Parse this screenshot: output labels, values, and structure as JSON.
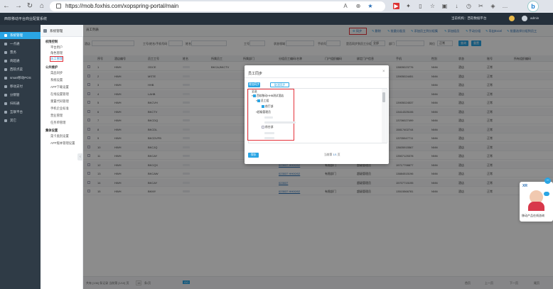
{
  "browser": {
    "url": "https://mob.foxhis.com/xopspring-portal/main"
  },
  "header": {
    "title": "西软移动平台商业配置系统",
    "right_org": "当前机构：西软数据平台",
    "right_user": "admin"
  },
  "sidebar": {
    "items": [
      {
        "label": "系统管理",
        "active": true
      },
      {
        "label": "一点通"
      },
      {
        "label": "票务"
      },
      {
        "label": "商超通"
      },
      {
        "label": "西软点菜"
      },
      {
        "label": "smart移动POS"
      },
      {
        "label": "移动支付"
      },
      {
        "label": "分销管"
      },
      {
        "label": "扫码通"
      },
      {
        "label": "互联平台"
      },
      {
        "label": "其它"
      }
    ]
  },
  "submenu": {
    "title": "系统管理",
    "groups": [
      {
        "label": "权限控制",
        "items": [
          "平台用户",
          "角色管理",
          "员工管理"
        ]
      },
      {
        "label": "公共维护",
        "items": [
          "菜品同步",
          "系统设置",
          "APP下载设置",
          "在线设置管理",
          "重置代码管理",
          "手机企业标准",
          "营业管理",
          "任务单管理"
        ]
      },
      {
        "label": "集体设置",
        "items": [
          "菜卡类别设置",
          "APP版本管理设置"
        ]
      }
    ],
    "highlighted": "员工管理"
  },
  "main": {
    "tab_label": "员工列表",
    "toolbar": [
      {
        "label": "同步"
      },
      {
        "label": "删除"
      },
      {
        "label": "批量分配员"
      },
      {
        "label": "添加员工到分组集"
      },
      {
        "label": "添加组员"
      },
      {
        "label": "手动分组"
      },
      {
        "label": "导出Excel"
      },
      {
        "label": "批量选择分组到员工"
      }
    ],
    "filters": [
      {
        "label": "酒店"
      },
      {
        "label": "工号/姓名/手机号码"
      },
      {
        "label": "姓名"
      },
      {
        "label": "工号"
      },
      {
        "label": "状态领域"
      },
      {
        "label": "手机号"
      },
      {
        "label": "是否同步到员工分组"
      },
      {
        "label": "部门"
      },
      {
        "label": "岗位"
      }
    ],
    "filter_values": {
      "status": "全部",
      "position": "正常"
    },
    "search_label": "查询",
    "reset_label": "重置",
    "columns": [
      "序号",
      "酒店编号",
      "员工工号",
      "姓名",
      "所属员工",
      "所属部门",
      "分组员工编码/名称",
      "门户组织编码",
      "绑定门户信息",
      "手机",
      "性别",
      "状态",
      "账号",
      "所有组织编码"
    ],
    "rows": [
      {
        "no": "1",
        "code": "HWH",
        "emp": "ODCE",
        "staff": "BKCA,BKCTV",
        "phone": "13805023776",
        "gender": "NNN",
        "unit": "酒店",
        "status": "正常"
      },
      {
        "no": "2",
        "code": "HWH",
        "emp": "MSTE",
        "staff": "",
        "phone": "13905024451",
        "gender": "NNN",
        "unit": "酒店",
        "status": "正常"
      },
      {
        "no": "3",
        "code": "HWH",
        "emp": "HHB",
        "staff": "",
        "phone": "",
        "gender": "NNN",
        "unit": "酒店",
        "status": "正常"
      },
      {
        "no": "4",
        "code": "HWH",
        "emp": "LAHB",
        "staff": "",
        "phone": "",
        "gender": "NNN",
        "unit": "酒店",
        "status": "正常"
      },
      {
        "no": "5",
        "code": "HWH",
        "emp": "BKCVH",
        "staff": "",
        "phone": "13905024537",
        "gender": "NNN",
        "unit": "酒店",
        "status": "正常"
      },
      {
        "no": "6",
        "code": "HWH",
        "emp": "BKCTV",
        "staff": "",
        "phone": "13414325106",
        "gender": "NNN",
        "unit": "酒店",
        "status": "正常"
      },
      {
        "no": "7",
        "code": "HWH",
        "emp": "BKCDQ",
        "staff": "",
        "phone": "13706027499",
        "gender": "NNN",
        "unit": "酒店",
        "status": "正常"
      },
      {
        "no": "8",
        "code": "HWH",
        "emp": "BKCDL",
        "staff": "",
        "phone": "15817402744",
        "gender": "NNN",
        "unit": "酒店",
        "status": "正常"
      },
      {
        "no": "9",
        "code": "HWH",
        "emp": "BKCDVFB",
        "staff": "",
        "phone": "13705947711",
        "gender": "NNN",
        "unit": "酒店",
        "status": "正常"
      },
      {
        "no": "10",
        "code": "HWH",
        "emp": "BKCJQ",
        "staff": "",
        "phone": "13605915567",
        "gender": "NNN",
        "unit": "酒店",
        "status": "正常"
      },
      {
        "no": "11",
        "code": "HWH",
        "emp": "BKCAY",
        "staff": "",
        "phone": "13507125378",
        "gender": "NNN",
        "unit": "酒店",
        "status": "正常"
      },
      {
        "no": "12",
        "code": "HWH",
        "emp": "BKCQX",
        "staff": "",
        "group": "023537 HH00/02",
        "dept": "有限部门",
        "portal": "超级管理员",
        "phone": "15717798877",
        "gender": "NNN",
        "unit": "酒店",
        "status": "正常"
      },
      {
        "no": "13",
        "code": "HWH",
        "emp": "BKCAW",
        "staff": "",
        "group": "023537 HH00/02",
        "dept": "有限部门",
        "portal": "超级管理员",
        "phone": "13884515196",
        "gender": "NNN",
        "unit": "酒店",
        "status": "正常"
      },
      {
        "no": "14",
        "code": "HWH",
        "emp": "BKCAY",
        "staff": "",
        "group": "023537",
        "dept": "",
        "portal": "超级管理员",
        "phone": "15707715195",
        "gender": "NNN",
        "unit": "酒店",
        "status": "正常"
      },
      {
        "no": "15",
        "code": "HWH",
        "emp": "BKMY",
        "staff": "",
        "group": "023537 HH00/02",
        "dept": "有限部门",
        "portal": "超级管理员",
        "phone": "13515566781",
        "gender": "NNN",
        "unit": "酒店",
        "status": "正常"
      }
    ]
  },
  "dialog": {
    "title": "员工同步",
    "close": "×",
    "btn_sync": "增加同步",
    "btn_cancel": "取消同步",
    "tree": {
      "root": "全选",
      "hotel": "西软移动HHB测试酒店",
      "level1": "员工组",
      "level2": "前厅部",
      "level3": "超级管理员",
      "leaf": "前台部"
    },
    "save_label": "保存",
    "pager_text": "当前第",
    "pager_page": "1/1",
    "pager_suffix": "页"
  },
  "footer": {
    "summary": "共有 [136] 条记录  当前第 [1/10] 页",
    "page_size": "15",
    "page_size_suffix": "条/页",
    "go": "GO",
    "nav": [
      "首页",
      "上一页",
      "下一页",
      "尾页"
    ]
  },
  "widget": {
    "text": "移动产品在线咨询"
  },
  "colors": {
    "accent": "#2aa5e4",
    "highlight": "#e5323a",
    "sidebar_bg": "#2f3b46",
    "header_bg": "#25303b"
  }
}
